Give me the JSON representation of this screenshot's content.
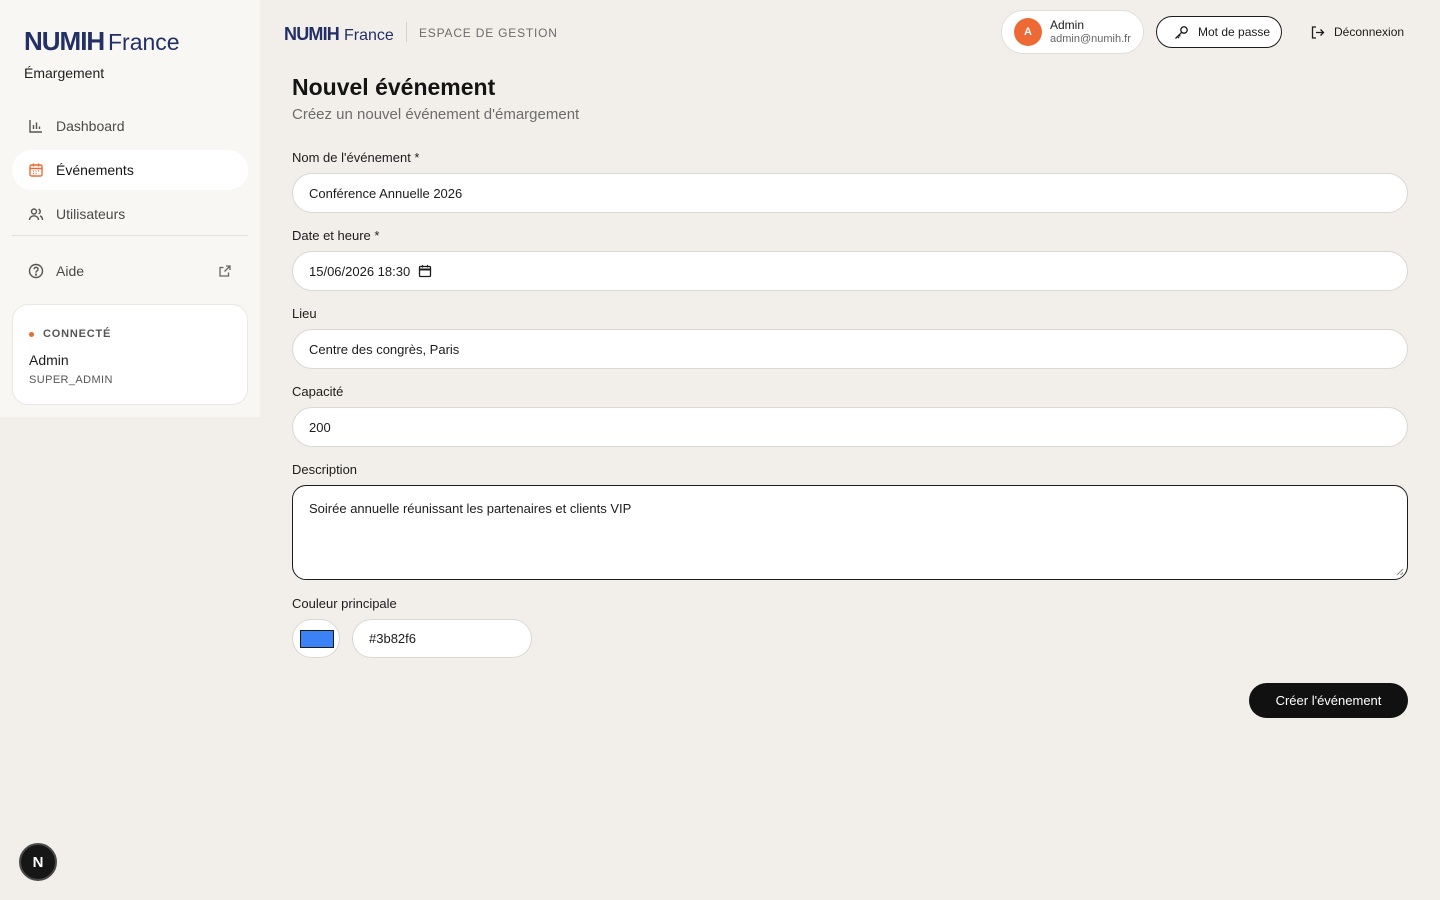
{
  "brand": {
    "name": "NUMIH France",
    "accent": "#ee6a35",
    "logo_color": "#233066"
  },
  "sidebar": {
    "subtitle": "Émargement",
    "items": [
      {
        "label": "Dashboard",
        "icon": "bar-chart-icon"
      },
      {
        "label": "Événements",
        "icon": "calendar-icon",
        "active": true
      },
      {
        "label": "Utilisateurs",
        "icon": "users-icon"
      },
      {
        "label": "Aide",
        "icon": "help-circle-icon",
        "external": true
      }
    ],
    "connection": {
      "status": "CONNECTÉ",
      "name": "Admin",
      "role": "SUPER_ADMIN"
    }
  },
  "header": {
    "space_label": "ESPACE DE GESTION",
    "user": {
      "initial": "A",
      "name": "Admin",
      "email": "admin@numih.fr"
    },
    "password_button": "Mot de passe",
    "logout_button": "Déconnexion"
  },
  "form": {
    "title": "Nouvel événement",
    "subtitle": "Créez un nouvel événement d'émargement",
    "fields": {
      "name": {
        "label": "Nom de l'événement *",
        "value": "Conférence Annuelle 2026"
      },
      "datetime": {
        "label": "Date et heure *",
        "value": "15/06/2026 18:30"
      },
      "location": {
        "label": "Lieu",
        "value": "Centre des congrès, Paris"
      },
      "capacity": {
        "label": "Capacité",
        "value": "200"
      },
      "description": {
        "label": "Description",
        "value": "Soirée annuelle réunissant les partenaires et clients VIP"
      },
      "color": {
        "label": "Couleur principale",
        "value": "#3b82f6"
      }
    },
    "submit_label": "Créer l'événement"
  },
  "dev_badge": {
    "letter": "N"
  }
}
